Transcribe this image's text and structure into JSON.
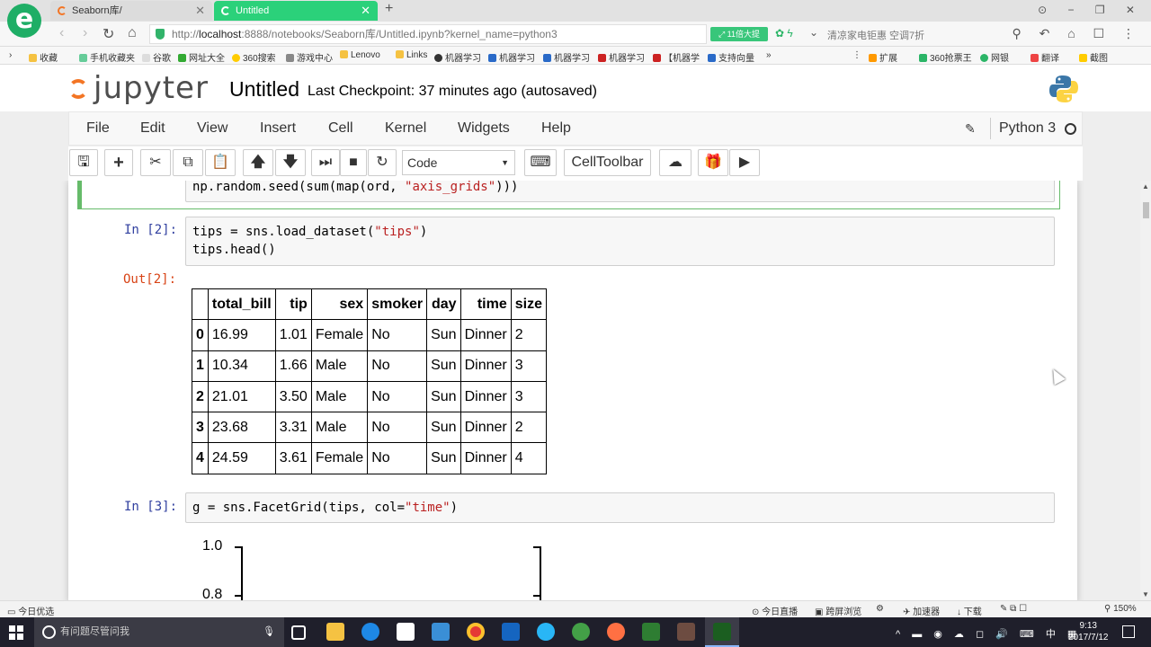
{
  "browser": {
    "tabs": [
      {
        "label": "Seaborn库/"
      },
      {
        "label": "Untitled"
      }
    ],
    "url_prefix": "http://",
    "url_host": "localhost",
    "url_rest": ":8888/notebooks/Seaborn库/Untitled.ipynb?kernel_name=python3",
    "speed_label": "⤢ 11倍大提",
    "news_text": "清凉家电钜惠 空调7折",
    "bookmarks": [
      "收藏",
      "手机收藏夹",
      "谷歌",
      "网址大全",
      "360搜索",
      "游戏中心",
      "Lenovo",
      "Links",
      "机器学习",
      "机器学习",
      "机器学习",
      "机器学习",
      "【机器学",
      "支持向量",
      "扩展",
      "360抢票王",
      "网银",
      "翻译",
      "截图"
    ]
  },
  "jupyter": {
    "logo_text": "jupyter",
    "notebook_title": "Untitled",
    "checkpoint": "Last Checkpoint: 37 minutes ago (autosaved)",
    "menu": [
      "File",
      "Edit",
      "View",
      "Insert",
      "Cell",
      "Kernel",
      "Widgets",
      "Help"
    ],
    "kernel_name": "Python 3",
    "cell_type": "Code",
    "celltoolbar_label": "CellToolbar"
  },
  "cells": {
    "prev_code_a": "np.random.seed(sum(map(ord, ",
    "prev_code_str": "\"axis_grids\"",
    "prev_code_b": ")))",
    "in2_prompt": "In [2]:",
    "in2_line1_a": "tips = sns.load_dataset(",
    "in2_line1_str": "\"tips\"",
    "in2_line1_b": ")",
    "in2_line2": "tips.head()",
    "out2_prompt": "Out[2]:",
    "in3_prompt": "In [3]:",
    "in3_code_a": "g = sns.FacetGrid(tips, col=",
    "in3_code_str": "\"time\"",
    "in3_code_b": ")"
  },
  "dataframe": {
    "columns": [
      "",
      "total_bill",
      "tip",
      "sex",
      "smoker",
      "day",
      "time",
      "size"
    ],
    "rows": [
      [
        "0",
        "16.99",
        "1.01",
        "Female",
        "No",
        "Sun",
        "Dinner",
        "2"
      ],
      [
        "1",
        "10.34",
        "1.66",
        "Male",
        "No",
        "Sun",
        "Dinner",
        "3"
      ],
      [
        "2",
        "21.01",
        "3.50",
        "Male",
        "No",
        "Sun",
        "Dinner",
        "3"
      ],
      [
        "3",
        "23.68",
        "3.31",
        "Male",
        "No",
        "Sun",
        "Dinner",
        "2"
      ],
      [
        "4",
        "24.59",
        "3.61",
        "Female",
        "No",
        "Sun",
        "Dinner",
        "4"
      ]
    ]
  },
  "plot": {
    "ytick_1": "1.0",
    "ytick_2": "0.8"
  },
  "statusbar": {
    "left": "今日优选",
    "live": "今日直播",
    "browse": "跨屏浏览",
    "accel": "加速器",
    "download": "下载",
    "zoom": "150%"
  },
  "taskbar": {
    "search_placeholder": "有问题尽管问我",
    "time": "9:13",
    "date": "2017/7/12",
    "ime": "中"
  }
}
